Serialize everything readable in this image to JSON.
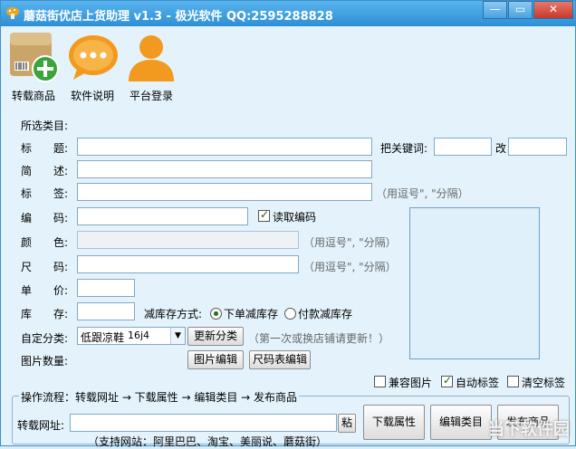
{
  "window": {
    "title": "蘑菇街优店上货助理 v1.3 - 极光软件 QQ:2595288828",
    "minimize": "—",
    "restore": "▭",
    "close": "✕"
  },
  "toolbar": [
    {
      "label": "转载商品",
      "icon": "box-add-icon"
    },
    {
      "label": "软件说明",
      "icon": "chat-bubble-icon"
    },
    {
      "label": "平台登录",
      "icon": "user-icon"
    }
  ],
  "form": {
    "category_label": "所选类目:",
    "title_label": "标　　题:",
    "title_value": "",
    "replace_label": "把关键词:",
    "replace_with_label": "改",
    "brief_label": "简　　述:",
    "tags_label": "标　　签:",
    "tags_hint": "（用逗号\", \"分隔）",
    "code_label": "编　　码:",
    "read_code_label": "读取编码",
    "read_code_checked": true,
    "color_label": "颜　　色:",
    "color_hint": "（用逗号\", \"分隔）",
    "size_label": "尺　　码:",
    "size_hint": "（用逗号\", \"分隔）",
    "price_label": "单　　价:",
    "stock_label": "库　　存:",
    "stock_mode_label": "减库存方式:",
    "stock_mode_options": [
      "下单减库存",
      "付款减库存"
    ],
    "stock_mode_selected": 0,
    "custom_cat_label": "自定分类:",
    "custom_cat_value": "低跟凉鞋",
    "custom_cat_value2": "16j4",
    "update_cat_button": "更新分类",
    "update_cat_hint": "（第一次或换店铺请更新！）",
    "image_count_label": "图片数量:",
    "edit_image_button": "图片编辑",
    "size_table_button": "尺码表编辑"
  },
  "options": [
    {
      "label": "兼容图片",
      "checked": false
    },
    {
      "label": "自动标签",
      "checked": true
    },
    {
      "label": "清空标签",
      "checked": false
    }
  ],
  "process": {
    "flow_text": "操作流程：转载网址 → 下载属性 → 编辑类目 → 发布商品",
    "url_label": "转载网址:",
    "paste_button": "粘",
    "download_button": "下载属性",
    "edit_cat_button": "编辑类目",
    "publish_button": "发布商品",
    "support_text": "（支持网站：阿里巴巴、淘宝、美丽说、蘑菇街）"
  },
  "watermark": "当下软件园"
}
